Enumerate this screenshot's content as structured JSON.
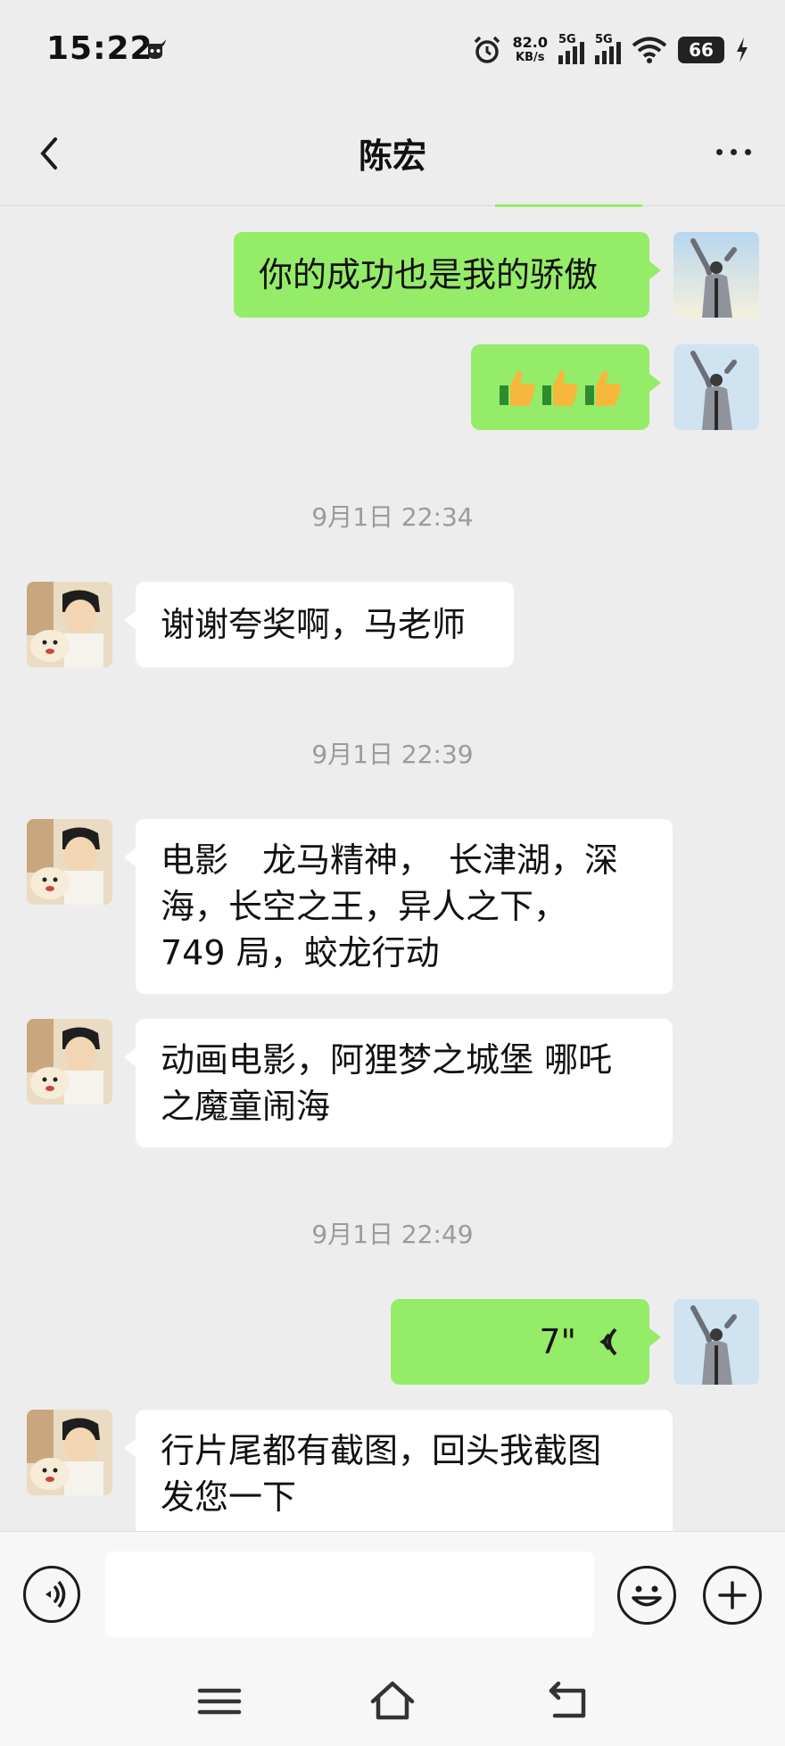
{
  "status_bar": {
    "time": "15:22",
    "speed_value": "82.0",
    "speed_unit": "KB/s",
    "sim1_label": "5G",
    "sim2_label": "5G",
    "battery": "66",
    "icons": [
      "bull-app-icon",
      "alarm-icon",
      "signal-icon",
      "wifi-icon",
      "battery-icon",
      "charging-icon"
    ]
  },
  "header": {
    "title": "陈宏",
    "back_icon": "back-chevron-icon",
    "more_icon": "more-dots-icon"
  },
  "messages": [
    {
      "sender": "me",
      "type": "text",
      "text": "你的成功也是我的骄傲"
    },
    {
      "sender": "me",
      "type": "emoji",
      "emoji": "👍👍👍"
    },
    {
      "type": "timestamp",
      "text": "9月1日 22:34"
    },
    {
      "sender": "other",
      "type": "text",
      "text": "谢谢夸奖啊，马老师"
    },
    {
      "type": "timestamp",
      "text": "9月1日 22:39"
    },
    {
      "sender": "other",
      "type": "text",
      "lines": [
        "电影　龙马精神，　长津湖，深",
        "海，长空之王，异人之下，",
        "749 局，蛟龙行动"
      ]
    },
    {
      "sender": "other",
      "type": "text",
      "lines": [
        "动画电影，阿狸梦之城堡  哪吒",
        "之魔童闹海"
      ]
    },
    {
      "type": "timestamp",
      "text": "9月1日 22:49"
    },
    {
      "sender": "me",
      "type": "voice",
      "duration": "7\""
    },
    {
      "sender": "other",
      "type": "text",
      "lines": [
        "行片尾都有截图，回头我截图",
        "发您一下"
      ]
    }
  ],
  "input_bar": {
    "voice_icon": "voice-input-icon",
    "emoji_icon": "emoji-icon",
    "plus_icon": "plus-icon",
    "input_value": ""
  },
  "nav_bar": {
    "icons": [
      "menu-icon",
      "home-icon",
      "back-icon"
    ]
  },
  "colors": {
    "my_bubble": "#95ec69",
    "other_bubble": "#ffffff",
    "background": "#ededed"
  }
}
